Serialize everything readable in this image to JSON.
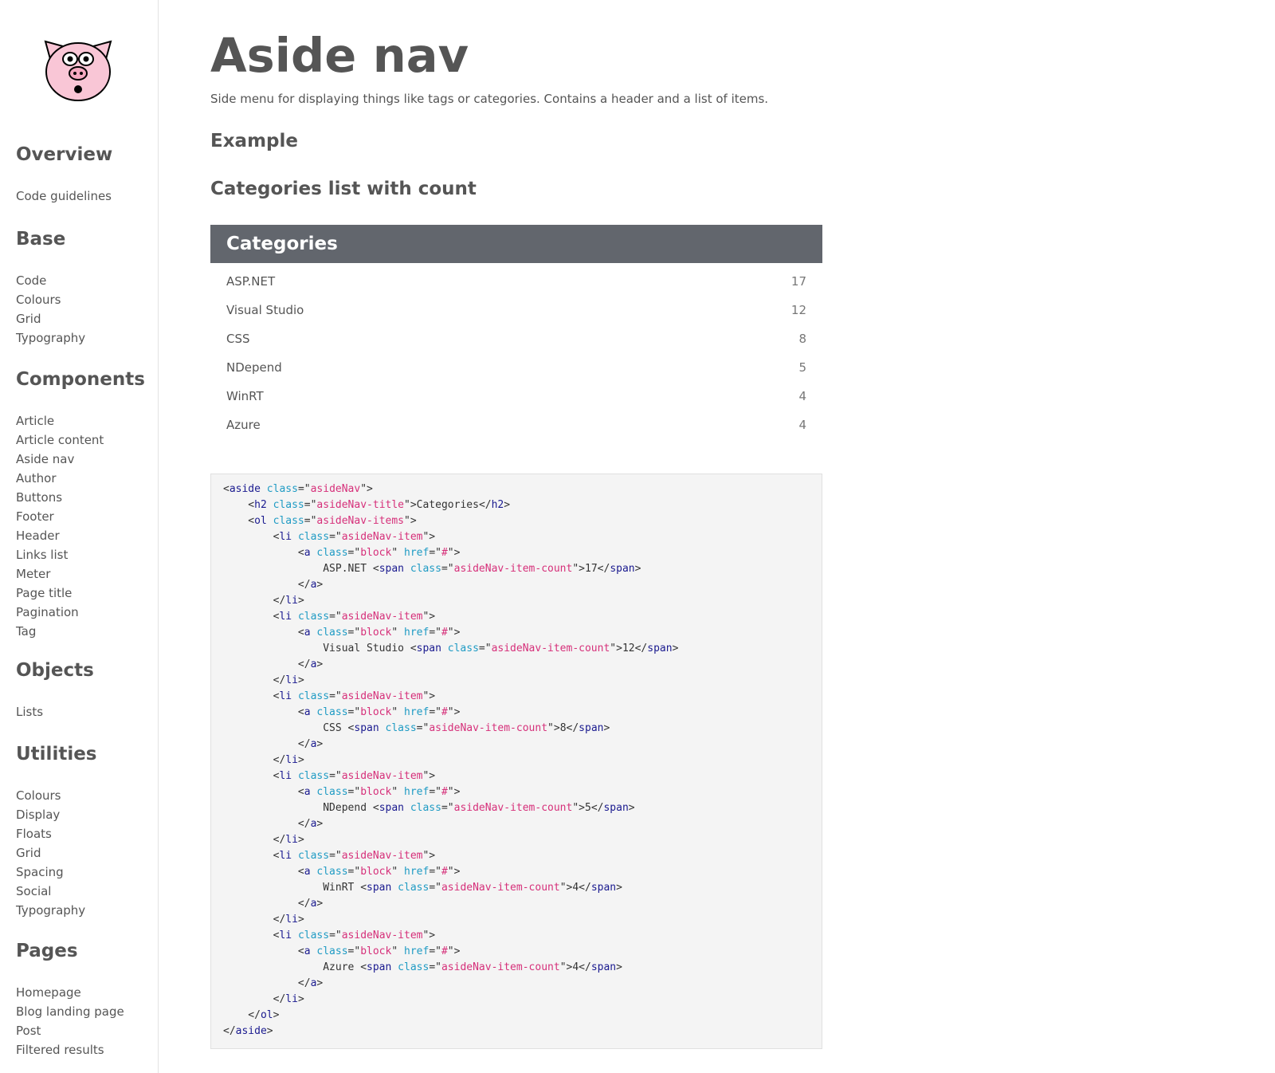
{
  "sidebar": {
    "logo_icon": "pig-logo-icon",
    "sections": [
      {
        "title": "Overview",
        "items": [
          "Code guidelines"
        ]
      },
      {
        "title": "Base",
        "items": [
          "Code",
          "Colours",
          "Grid",
          "Typography"
        ]
      },
      {
        "title": "Components",
        "items": [
          "Article",
          "Article content",
          "Aside nav",
          "Author",
          "Buttons",
          "Footer",
          "Header",
          "Links list",
          "Meter",
          "Page title",
          "Pagination",
          "Tag"
        ]
      },
      {
        "title": "Objects",
        "items": [
          "Lists"
        ]
      },
      {
        "title": "Utilities",
        "items": [
          "Colours",
          "Display",
          "Floats",
          "Grid",
          "Spacing",
          "Social",
          "Typography"
        ]
      },
      {
        "title": "Pages",
        "items": [
          "Homepage",
          "Blog landing page",
          "Post",
          "Filtered results"
        ]
      }
    ]
  },
  "main": {
    "title": "Aside nav",
    "intro": "Side menu for displaying things like tags or categories. Contains a header and a list of items.",
    "example_heading": "Example",
    "sub_heading": "Categories list with count",
    "demo": {
      "title": "Categories",
      "items": [
        {
          "label": "ASP.NET",
          "count": "17"
        },
        {
          "label": "Visual Studio",
          "count": "12"
        },
        {
          "label": "CSS",
          "count": "8"
        },
        {
          "label": "NDepend",
          "count": "5"
        },
        {
          "label": "WinRT",
          "count": "4"
        },
        {
          "label": "Azure",
          "count": "4"
        }
      ]
    },
    "code": {
      "colors": {
        "tag": "#1a1a8f",
        "attr": "#1f9bc4",
        "value": "#d6307a",
        "background": "#f4f4f4"
      },
      "lines": [
        "<aside class=\"asideNav\">",
        "    <h2 class=\"asideNav-title\">Categories</h2>",
        "    <ol class=\"asideNav-items\">",
        "        <li class=\"asideNav-item\">",
        "            <a class=\"block\" href=\"#\">",
        "                ASP.NET <span class=\"asideNav-item-count\">17</span>",
        "            </a>",
        "        </li>",
        "        <li class=\"asideNav-item\">",
        "            <a class=\"block\" href=\"#\">",
        "                Visual Studio <span class=\"asideNav-item-count\">12</span>",
        "            </a>",
        "        </li>",
        "        <li class=\"asideNav-item\">",
        "            <a class=\"block\" href=\"#\">",
        "                CSS <span class=\"asideNav-item-count\">8</span>",
        "            </a>",
        "        </li>",
        "        <li class=\"asideNav-item\">",
        "            <a class=\"block\" href=\"#\">",
        "                NDepend <span class=\"asideNav-item-count\">5</span>",
        "            </a>",
        "        </li>",
        "        <li class=\"asideNav-item\">",
        "            <a class=\"block\" href=\"#\">",
        "                WinRT <span class=\"asideNav-item-count\">4</span>",
        "            </a>",
        "        </li>",
        "        <li class=\"asideNav-item\">",
        "            <a class=\"block\" href=\"#\">",
        "                Azure <span class=\"asideNav-item-count\">4</span>",
        "            </a>",
        "        </li>",
        "    </ol>",
        "</aside>"
      ]
    }
  }
}
